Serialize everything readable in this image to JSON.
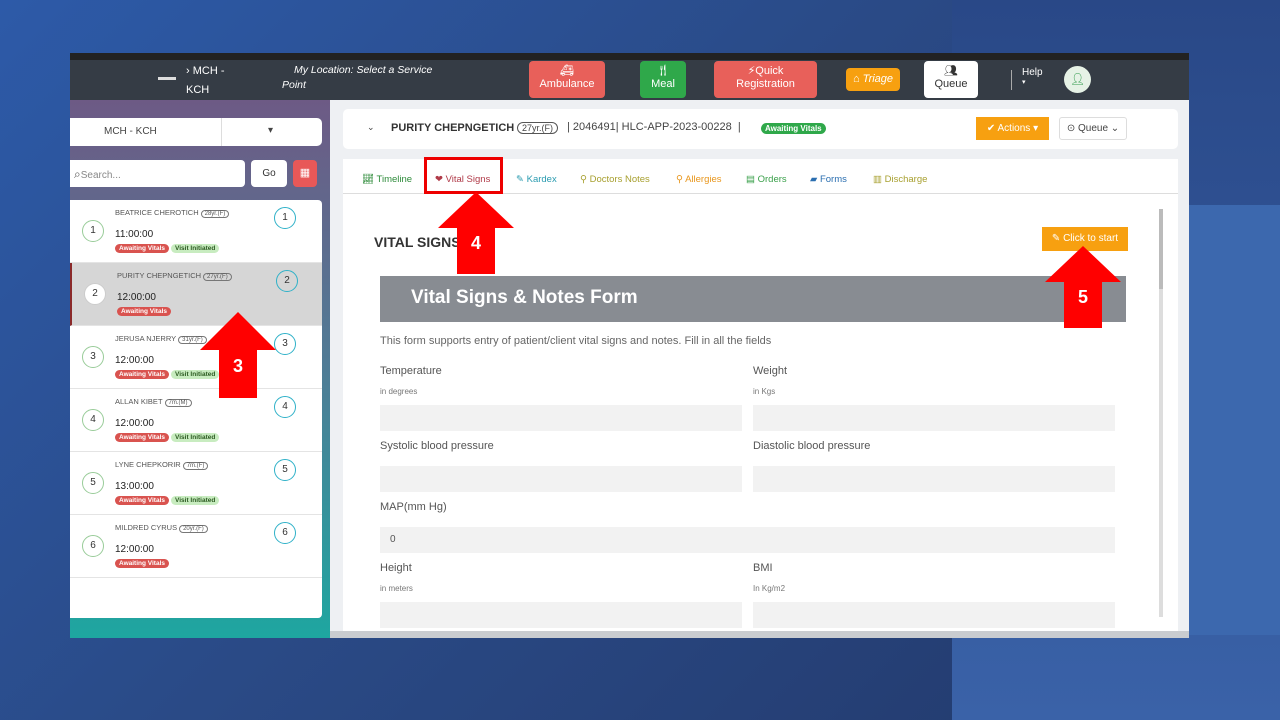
{
  "topbar": {
    "facility": "MCH -",
    "facility2": "KCH",
    "location": "My Location: Select a Service",
    "location2": "Point",
    "ambulance": "Ambulance",
    "meal": "Meal",
    "quick_reg": "Quick",
    "quick_reg2": "Registration",
    "triage": "Triage",
    "queue": "Queue",
    "help": "Help"
  },
  "sidebar": {
    "select_value": "MCH - KCH",
    "search_placeholder": "Search...",
    "go_label": "Go",
    "patients": [
      {
        "num": "1",
        "name": "BEATRICE CHEROTICH",
        "age": "28yr.(F)",
        "time": "11:00:00",
        "badges": [
          "Awaiting Vitals",
          "Visit Initiated"
        ]
      },
      {
        "num": "2",
        "name": "PURITY CHEPNGETICH",
        "age": "27yr.(F)",
        "time": "12:00:00",
        "badges": [
          "Awaiting Vitals"
        ]
      },
      {
        "num": "3",
        "name": "JERUSA NJERRY",
        "age": "31yr.(F)",
        "time": "12:00:00",
        "badges": [
          "Awaiting Vitals",
          "Visit Initiated"
        ]
      },
      {
        "num": "4",
        "name": "ALLAN KIBET",
        "age": "7m.(M)",
        "time": "12:00:00",
        "badges": [
          "Awaiting Vitals",
          "Visit Initiated"
        ]
      },
      {
        "num": "5",
        "name": "LYNE CHEPKORIR",
        "age": "7m.(F)",
        "time": "13:00:00",
        "badges": [
          "Awaiting Vitals",
          "Visit Initiated"
        ]
      },
      {
        "num": "6",
        "name": "MILDRED CYRUS",
        "age": "20yr.(F)",
        "time": "12:00:00",
        "badges": [
          "Awaiting Vitals"
        ]
      }
    ]
  },
  "header": {
    "patient_name": "PURITY CHEPNGETICH",
    "age": "27yr.(F)",
    "patient_id": "2046491",
    "visit_id": "HLC-APP-2023-00228",
    "status": "Awaiting Vitals",
    "actions": "Actions",
    "queue": "Queue"
  },
  "tabs": [
    {
      "label": "Timeline",
      "color": "#2e8b3a"
    },
    {
      "label": "Vital Signs",
      "color": "#b03a48"
    },
    {
      "label": "Kardex",
      "color": "#2a9bb0"
    },
    {
      "label": "Doctors Notes",
      "color": "#a8a030"
    },
    {
      "label": "Allergies",
      "color": "#e8961c"
    },
    {
      "label": "Orders",
      "color": "#3aa04a"
    },
    {
      "label": "Forms",
      "color": "#2a6eb0"
    },
    {
      "label": "Discharge",
      "color": "#a8a030"
    }
  ],
  "content": {
    "title": "VITAL SIGNS",
    "start_button": "Click to start",
    "form_title": "Vital Signs & Notes Form",
    "form_desc": "This form supports entry of patient/client vital signs and notes. Fill in all the fields",
    "fields": {
      "temperature": "Temperature",
      "temperature_unit": "in degrees",
      "weight": "Weight",
      "weight_unit": "in Kgs",
      "systolic": "Systolic blood pressure",
      "diastolic": "Diastolic blood pressure",
      "map": "MAP(mm Hg)",
      "map_value": "0",
      "height": "Height",
      "height_unit": "in meters",
      "bmi": "BMI",
      "bmi_unit": "In Kg/m2"
    }
  },
  "annotations": {
    "step3": "3",
    "step4": "4",
    "step5": "5",
    "color": "#ff0000"
  }
}
